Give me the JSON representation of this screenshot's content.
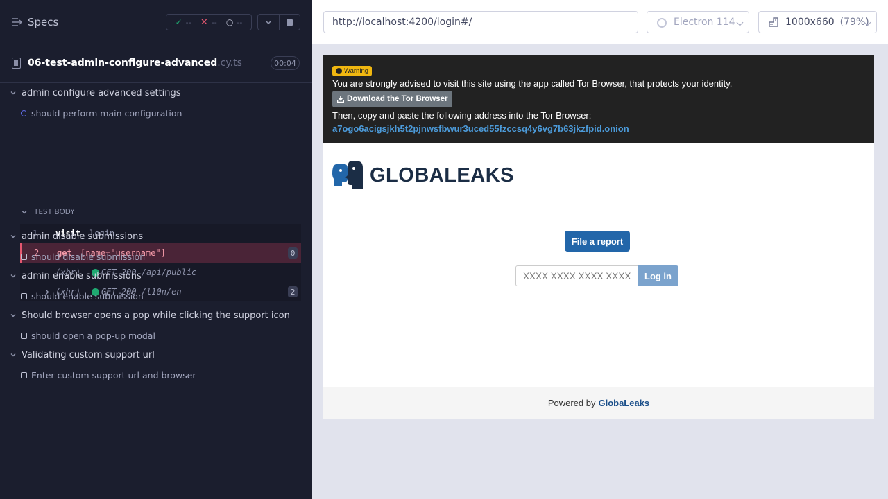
{
  "reporter": {
    "specs_label": "Specs",
    "stats": {
      "passed": "--",
      "failed": "--",
      "pending": "--"
    },
    "spec_file": {
      "name": "06-test-admin-configure-advanced",
      "ext": ".cy.ts",
      "duration": "00:04"
    },
    "suites": [
      {
        "title": "admin configure advanced settings",
        "test": "should perform main configuration"
      },
      {
        "title": "admin disable submissions",
        "test": "should disable submission"
      },
      {
        "title": "admin enable submissions",
        "test": "should enable submission"
      },
      {
        "title": "Should browser opens a pop while clicking the support icon",
        "test": "should open a pop-up modal"
      },
      {
        "title": "Validating custom support url",
        "test": "Enter custom support url and browser"
      }
    ],
    "test_body_label": "TEST BODY",
    "commands": [
      {
        "num": "1",
        "name": "visit",
        "arg": "login"
      },
      {
        "num": "2",
        "name": "get",
        "arg": "[name=\"username\"]",
        "badge": "0"
      }
    ],
    "requests": [
      {
        "type": "(xhr)",
        "text": "GET 200 /api/public"
      },
      {
        "type": "(xhr)",
        "text": "GET 200 /l10n/en",
        "badge": "2"
      }
    ]
  },
  "aut": {
    "url": "http://localhost:4200/login#/",
    "browser": "Electron 114",
    "viewport": "1000x660",
    "zoom": "(79%)"
  },
  "page": {
    "warning_label": "Warning",
    "tor_line1": "You are strongly advised to visit this site using the app called Tor Browser, that protects your identity.",
    "download_label": "Download the Tor Browser",
    "tor_line2": "Then, copy and paste the following address into the Tor Browser: ",
    "onion_address": "a7ogo6acigsjkh5t2pjnwsfbwur3uced55fzccsq4y6vg7b63jkzfpid.onion",
    "logo_text": "GLOBALEAKS",
    "file_report": "File a report",
    "receipt_placeholder": "XXXX XXXX XXXX XXXX",
    "login_label": "Log in",
    "footer_prefix": "Powered by",
    "footer_brand": "GlobaLeaks"
  },
  "colors": {
    "reporter_bg": "#1b1e2e",
    "fail": "#e45770",
    "pass": "#1fa971",
    "brand_blue": "#2266a9",
    "warning": "#f0b710"
  }
}
